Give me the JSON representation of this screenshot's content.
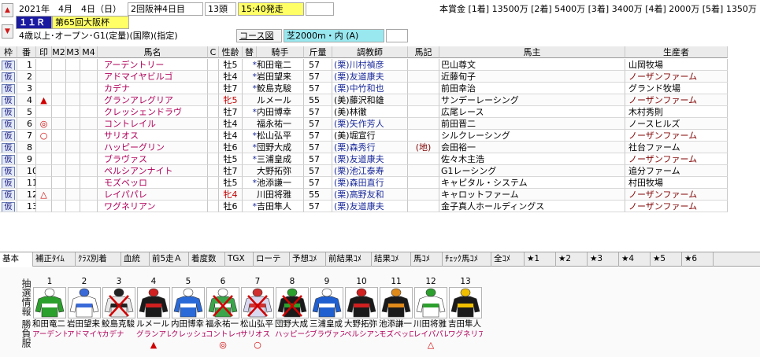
{
  "header": {
    "date": "2021年　4月　4日（日）",
    "meeting": "2回阪神4日目",
    "runners": "13頭",
    "post_time": "15:40発走",
    "race_no": "１１Ｒ",
    "race_name": "第65回大阪杯",
    "conditions": "4歳以上･オープン･G1(定量)(国際)(指定)",
    "course_label": "コース図",
    "course": "芝2000m・内 (A)",
    "prize": "本賞金 [1着] 13500万 [2着] 5400万 [3着] 3400万 [4着] 2000万 [5着] 1350万"
  },
  "columns": [
    "枠",
    "番",
    "印",
    "M2",
    "M3",
    "M4",
    "馬名",
    "C",
    "性齢",
    "替",
    "騎手",
    "斤量",
    "調教師",
    "馬記",
    "馬主",
    "生産者"
  ],
  "entries": [
    {
      "waku": "仮",
      "num": "1",
      "mark": "",
      "name": "アーデントリー",
      "sex": "牡5",
      "chg": "*",
      "jockey": "和田竜二",
      "weight": "57",
      "trainer": "(栗)川村禎彦",
      "tk": "",
      "owner": "巴山尊文",
      "breeder": "山岡牧場"
    },
    {
      "waku": "仮",
      "num": "2",
      "mark": "",
      "name": "アドマイヤビルゴ",
      "sex": "牡4",
      "chg": "*",
      "jockey": "岩田望来",
      "weight": "57",
      "trainer": "(栗)友道康夫",
      "tk": "",
      "owner": "近藤旬子",
      "breeder": "ノーザンファーム"
    },
    {
      "waku": "仮",
      "num": "3",
      "mark": "",
      "name": "カデナ",
      "sex": "牡7",
      "chg": "*",
      "jockey": "鮫島克駿",
      "weight": "57",
      "trainer": "(栗)中竹和也",
      "tk": "",
      "owner": "前田幸治",
      "breeder": "グランド牧場"
    },
    {
      "waku": "仮",
      "num": "4",
      "mark": "▲",
      "name": "グランアレグリア",
      "sex": "牝5",
      "chg": "",
      "jockey": "ルメール",
      "weight": "55",
      "trainer": "(美)藤沢和雄",
      "tk": "",
      "owner": "サンデーレーシング",
      "breeder": "ノーザンファーム"
    },
    {
      "waku": "仮",
      "num": "5",
      "mark": "",
      "name": "クレッシェンドラヴ",
      "sex": "牡7",
      "chg": "*",
      "jockey": "内田博幸",
      "weight": "57",
      "trainer": "(美)林徹",
      "tk": "",
      "owner": "広尾レース",
      "breeder": "木村秀則"
    },
    {
      "waku": "仮",
      "num": "6",
      "mark": "◎",
      "name": "コントレイル",
      "sex": "牡4",
      "chg": "",
      "jockey": "福永祐一",
      "weight": "57",
      "trainer": "(栗)矢作芳人",
      "tk": "",
      "owner": "前田晋二",
      "breeder": "ノースヒルズ"
    },
    {
      "waku": "仮",
      "num": "7",
      "mark": "○",
      "name": "サリオス",
      "sex": "牡4",
      "chg": "*",
      "jockey": "松山弘平",
      "weight": "57",
      "trainer": "(美)堀宣行",
      "tk": "",
      "owner": "シルクレーシング",
      "breeder": "ノーザンファーム"
    },
    {
      "waku": "仮",
      "num": "8",
      "mark": "",
      "name": "ハッピーグリン",
      "sex": "牡6",
      "chg": "*",
      "jockey": "団野大成",
      "weight": "57",
      "trainer": "(栗)森秀行",
      "tk": "(地)",
      "owner": "会田裕一",
      "breeder": "社台ファーム"
    },
    {
      "waku": "仮",
      "num": "9",
      "mark": "",
      "name": "ブラヴァス",
      "sex": "牡5",
      "chg": "*",
      "jockey": "三浦皇成",
      "weight": "57",
      "trainer": "(栗)友道康夫",
      "tk": "",
      "owner": "佐々木主浩",
      "breeder": "ノーザンファーム"
    },
    {
      "waku": "仮",
      "num": "10",
      "mark": "",
      "name": "ペルシアンナイト",
      "sex": "牡7",
      "chg": "",
      "jockey": "大野拓弥",
      "weight": "57",
      "trainer": "(栗)池江泰寿",
      "tk": "",
      "owner": "G1レーシング",
      "breeder": "追分ファーム"
    },
    {
      "waku": "仮",
      "num": "11",
      "mark": "",
      "name": "モズベッロ",
      "sex": "牡5",
      "chg": "*",
      "jockey": "池添謙一",
      "weight": "57",
      "trainer": "(栗)森田直行",
      "tk": "",
      "owner": "キャピタル・システム",
      "breeder": "村田牧場"
    },
    {
      "waku": "仮",
      "num": "12",
      "mark": "△",
      "name": "レイパパレ",
      "sex": "牝4",
      "chg": "",
      "jockey": "川田将雅",
      "weight": "55",
      "trainer": "(栗)高野友和",
      "tk": "",
      "owner": "キャロットファーム",
      "breeder": "ノーザンファーム"
    },
    {
      "waku": "仮",
      "num": "13",
      "mark": "",
      "name": "ワグネリアン",
      "sex": "牡6",
      "chg": "*",
      "jockey": "吉田隼人",
      "weight": "57",
      "trainer": "(栗)友道康夫",
      "tk": "",
      "owner": "金子真人ホールディングス",
      "breeder": "ノーザンファーム"
    }
  ],
  "tabs": [
    "基本",
    "補正ﾀｲﾑ",
    "ｸﾗｽ別着",
    "血統",
    "前5走Ａ",
    "着度数",
    "TGX",
    "ローテ",
    "予想ｺﾒ",
    "前結果ｺﾒ",
    "結果ｺﾒ",
    "馬ｺﾒ",
    "ﾁｪｯｸ馬ｺﾒ",
    "全ｺﾒ",
    "★1",
    "★2",
    "★3",
    "★4",
    "★5",
    "★6"
  ],
  "panel": {
    "side_label": "抽選情報\n勝負服",
    "silks": [
      {
        "num": "1",
        "jockey": "和田竜二",
        "horse": "アーデントリー",
        "mark": "",
        "body": "#2ca02c",
        "accent": "#ffffff",
        "cross": false
      },
      {
        "num": "2",
        "jockey": "岩田望来",
        "horse": "アドマイヤビルゴ",
        "mark": "",
        "body": "#ffffff",
        "accent": "#3a6ad8",
        "cross": false
      },
      {
        "num": "3",
        "jockey": "鮫島克駿",
        "horse": "カデナ",
        "mark": "",
        "body": "#e8e8e8",
        "accent": "#222222",
        "cross": true
      },
      {
        "num": "4",
        "jockey": "ルメール",
        "horse": "グランアレグリア",
        "mark": "▲",
        "body": "#1a1a1a",
        "accent": "#d02020",
        "cross": false
      },
      {
        "num": "5",
        "jockey": "内田博幸",
        "horse": "クレッシェンドラヴ",
        "mark": "",
        "body": "#2a6ad8",
        "accent": "#ffffff",
        "cross": false
      },
      {
        "num": "6",
        "jockey": "福永祐一",
        "horse": "コントレイル",
        "mark": "◎",
        "body": "#3aa54a",
        "accent": "#ffffff",
        "cross": true
      },
      {
        "num": "7",
        "jockey": "松山弘平",
        "horse": "サリオス",
        "mark": "○",
        "body": "#d8d8f0",
        "accent": "#d03030",
        "cross": true
      },
      {
        "num": "8",
        "jockey": "団野大成",
        "horse": "ハッピーグリン",
        "mark": "",
        "body": "#1a1a1a",
        "accent": "#2ca02c",
        "cross": true
      },
      {
        "num": "9",
        "jockey": "三浦皇成",
        "horse": "ブラヴァス",
        "mark": "",
        "body": "#1f5fd0",
        "accent": "#ffffff",
        "cross": false
      },
      {
        "num": "10",
        "jockey": "大野拓弥",
        "horse": "ペルシアンナイト",
        "mark": "",
        "body": "#1a1a1a",
        "accent": "#d02020",
        "cross": false
      },
      {
        "num": "11",
        "jockey": "池添謙一",
        "horse": "モズベッロ",
        "mark": "",
        "body": "#1a1a1a",
        "accent": "#e08a1a",
        "cross": false
      },
      {
        "num": "12",
        "jockey": "川田将雅",
        "horse": "レイパパレ",
        "mark": "△",
        "body": "#ffffff",
        "accent": "#2ca02c",
        "cross": false
      },
      {
        "num": "13",
        "jockey": "吉田隼人",
        "horse": "ワグネリアン",
        "mark": "",
        "body": "#1a1a1a",
        "accent": "#f0c000",
        "cross": false
      }
    ]
  },
  "colors": {
    "accent_yellow": "#ffff66",
    "accent_cyan": "#99e8f0",
    "race_no_bg": "#1a1aa0",
    "horse_name": "#b0005a",
    "mark_red": "#d00000"
  }
}
